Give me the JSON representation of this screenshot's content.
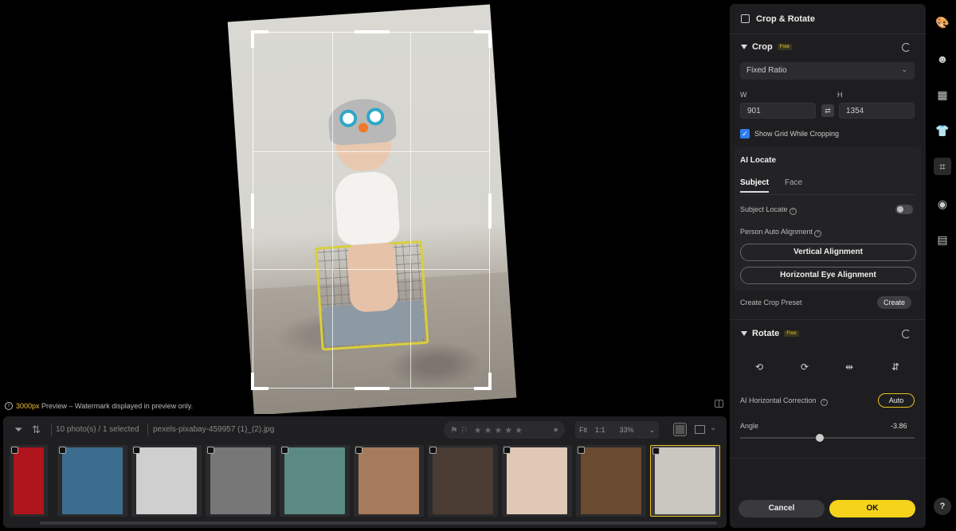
{
  "canvas": {
    "preview_size": "3000px",
    "preview_note": " Preview – Watermark displayed in preview only."
  },
  "filmstrip": {
    "photo_count": "10 photo(s) / 1 selected",
    "file_name": "pexels-pixabay-459957 (1)_(2).jpg",
    "zoom_fit": "Fit",
    "zoom_1to1": "1:1",
    "zoom_level": "33%",
    "rating_stars": 0,
    "thumbnails": [
      {
        "name": "spiral",
        "color": "#b0141c"
      },
      {
        "name": "canal-town",
        "color": "#3d6d8e"
      },
      {
        "name": "staircase",
        "color": "#cfcfcf"
      },
      {
        "name": "man-in-suit",
        "color": "#777777"
      },
      {
        "name": "smiling-woman",
        "color": "#5a8a83"
      },
      {
        "name": "smiling-man",
        "color": "#a57b5c"
      },
      {
        "name": "laughing-woman",
        "color": "#4a3b33"
      },
      {
        "name": "woman-with-scarf",
        "color": "#dfc9b5"
      },
      {
        "name": "girl-portrait",
        "color": "#6b4a32"
      },
      {
        "name": "baby-crop",
        "color": "#c9c7bf",
        "selected": true
      }
    ]
  },
  "panel": {
    "title": "Crop & Rotate",
    "crop": {
      "title": "Crop",
      "badge": "Free",
      "ratio_value": "Fixed Ratio",
      "w_label": "W",
      "h_label": "H",
      "w_value": "901",
      "h_value": "1354",
      "show_grid_label": "Show Grid While Cropping",
      "show_grid_checked": true
    },
    "ai_locate": {
      "title": "AI Locate",
      "tab_subject": "Subject",
      "tab_face": "Face",
      "subject_locate_label": "Subject Locate",
      "subject_locate_on": false,
      "person_auto_label": "Person Auto Alignment",
      "vertical_btn": "Vertical Alignment",
      "horizontal_btn": "Horizontal Eye Alignment"
    },
    "create_preset_label": "Create Crop Preset",
    "create_btn": "Create",
    "rotate": {
      "title": "Rotate",
      "badge": "Free",
      "ai_correction_label": "AI Horizontal Correction",
      "auto_btn": "Auto",
      "angle_label": "Angle",
      "angle_value": "-3.86",
      "angle_min": -45,
      "angle_max": 45
    },
    "cancel_btn": "Cancel",
    "ok_btn": "OK"
  },
  "rail": {
    "items": [
      "palette-icon",
      "face-icon",
      "texture-icon",
      "clothing-icon",
      "crop-icon",
      "camera-icon",
      "folder-icon"
    ],
    "active": "crop-icon",
    "help": "?"
  },
  "colors": {
    "accent": "#f5d31a",
    "checkbox": "#2f7bf0"
  }
}
